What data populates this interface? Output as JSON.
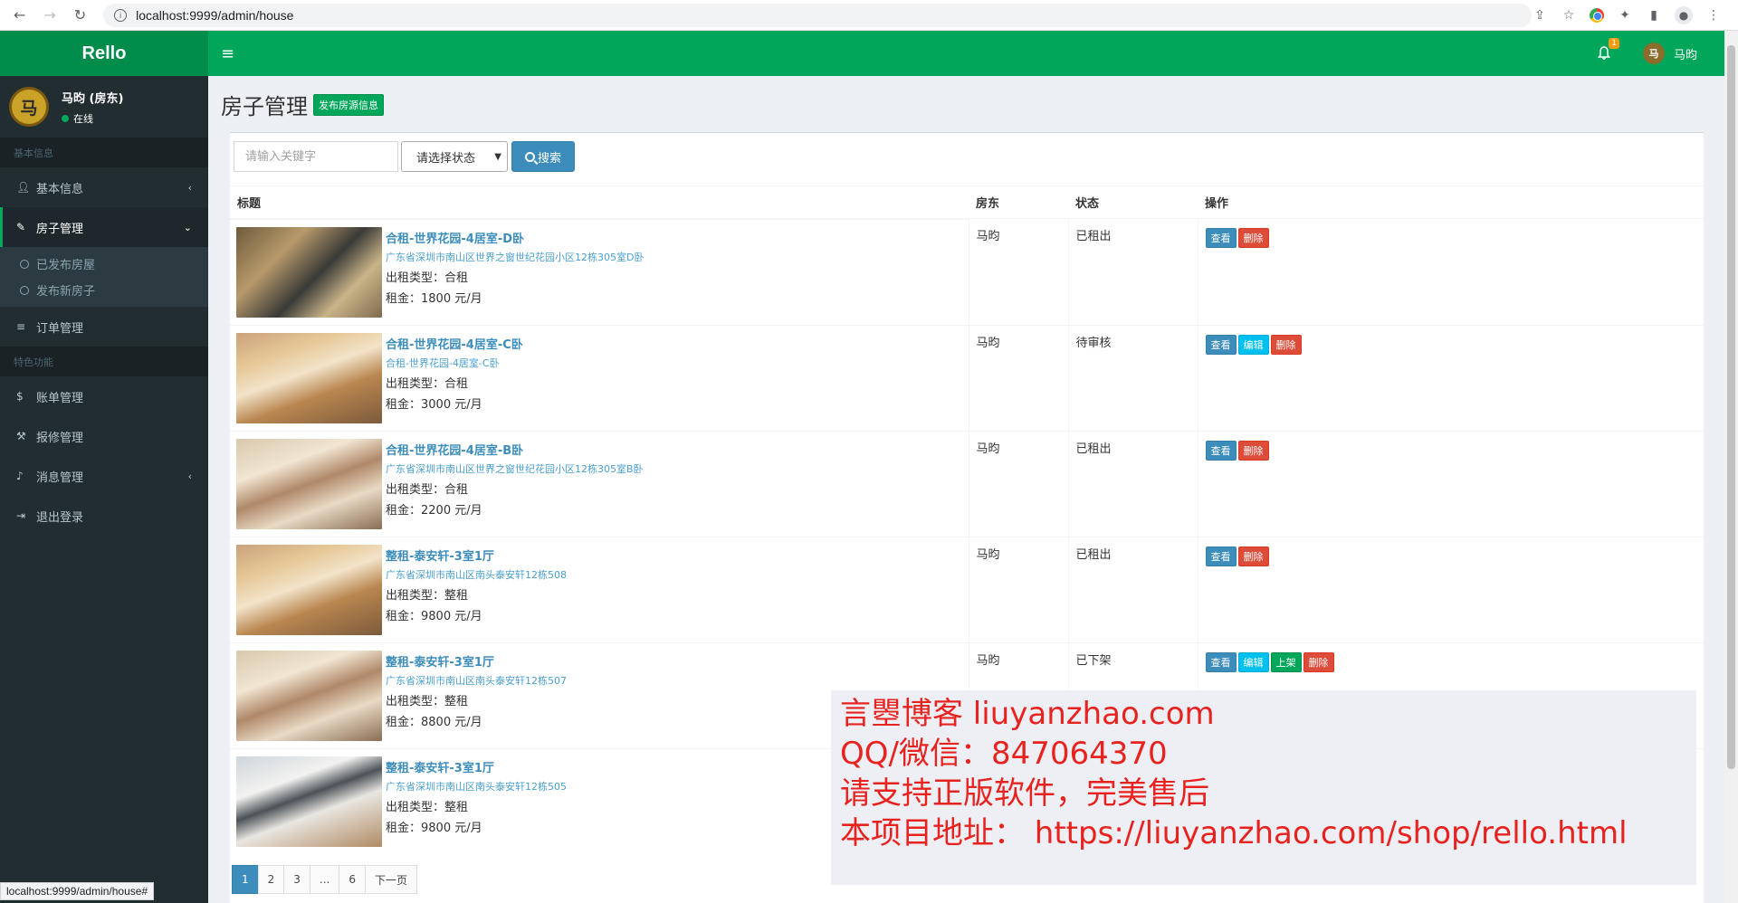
{
  "browser": {
    "url": "localhost:9999/admin/house",
    "status_url": "localhost:9999/admin/house#"
  },
  "header": {
    "logo": "Rello",
    "notification_count": "1",
    "user_avatar_char": "马",
    "user_name": "马昀"
  },
  "sidebar": {
    "user": {
      "avatar_char": "马",
      "name": "马昀 (房东)",
      "status": "在线"
    },
    "sections": [
      {
        "title": "基本信息"
      },
      {
        "title": "特色功能"
      }
    ],
    "items": [
      {
        "label": "基本信息",
        "icon": "user-icon"
      },
      {
        "label": "房子管理",
        "icon": "brush-icon"
      },
      {
        "label": "已发布房屋"
      },
      {
        "label": "发布新房子"
      },
      {
        "label": "订单管理",
        "icon": "database-icon"
      },
      {
        "label": "账单管理",
        "icon": "dollar-icon"
      },
      {
        "label": "报修管理",
        "icon": "wrench-icon"
      },
      {
        "label": "消息管理",
        "icon": "bell-icon"
      },
      {
        "label": "退出登录",
        "icon": "logout-icon"
      }
    ]
  },
  "page": {
    "title": "房子管理",
    "publish_button": "发布房源信息"
  },
  "search": {
    "placeholder": "请输入关键字",
    "status_select": "请选择状态",
    "button": "搜索"
  },
  "table": {
    "headers": [
      "标题",
      "房东",
      "状态",
      "操作"
    ],
    "rows": [
      {
        "title": "合租-世界花园-4居室-D卧",
        "address": "广东省深圳市南山区世界之窗世纪花园小区12栋305室D卧",
        "type_label": "出租类型：",
        "type": "合租",
        "rent_label": "租金：",
        "rent": "1800 元/月",
        "landlord": "马昀",
        "status": "已租出",
        "actions": [
          "查看",
          "删除"
        ]
      },
      {
        "title": "合租-世界花园-4居室-C卧",
        "address": "合租-世界花园-4居室-C卧",
        "type_label": "出租类型：",
        "type": "合租",
        "rent_label": "租金：",
        "rent": "3000 元/月",
        "landlord": "马昀",
        "status": "待审核",
        "actions": [
          "查看",
          "编辑",
          "删除"
        ]
      },
      {
        "title": "合租-世界花园-4居室-B卧",
        "address": "广东省深圳市南山区世界之窗世纪花园小区12栋305室B卧",
        "type_label": "出租类型：",
        "type": "合租",
        "rent_label": "租金：",
        "rent": "2200 元/月",
        "landlord": "马昀",
        "status": "已租出",
        "actions": [
          "查看",
          "删除"
        ]
      },
      {
        "title": "整租-泰安轩-3室1厅",
        "address": "广东省深圳市南山区南头泰安轩12栋508",
        "type_label": "出租类型：",
        "type": "整租",
        "rent_label": "租金：",
        "rent": "9800 元/月",
        "landlord": "马昀",
        "status": "已租出",
        "actions": [
          "查看",
          "删除"
        ]
      },
      {
        "title": "整租-泰安轩-3室1厅",
        "address": "广东省深圳市南山区南头泰安轩12栋507",
        "type_label": "出租类型：",
        "type": "整租",
        "rent_label": "租金：",
        "rent": "8800 元/月",
        "landlord": "马昀",
        "status": "已下架",
        "actions": [
          "查看",
          "编辑",
          "上架",
          "删除"
        ]
      },
      {
        "title": "整租-泰安轩-3室1厅",
        "address": "广东省深圳市南山区南头泰安轩12栋505",
        "type_label": "出租类型：",
        "type": "整租",
        "rent_label": "租金：",
        "rent": "9800 元/月",
        "landlord": "",
        "status": "",
        "actions": []
      }
    ]
  },
  "pagination": [
    "1",
    "2",
    "3",
    "...",
    "6",
    "下一页"
  ],
  "watermark": [
    "言瞾博客 liuyanzhao.com",
    "QQ/微信：847064370",
    "请支持正版软件，完美售后",
    "本项目地址： https://liuyanzhao.com/shop/rello.html"
  ],
  "colors": {
    "header": "#00a65a",
    "sidebar": "#222d32",
    "primary": "#3c8dbc",
    "danger": "#dd4b39",
    "info": "#00c0ef",
    "watermark": "#e8231f"
  }
}
